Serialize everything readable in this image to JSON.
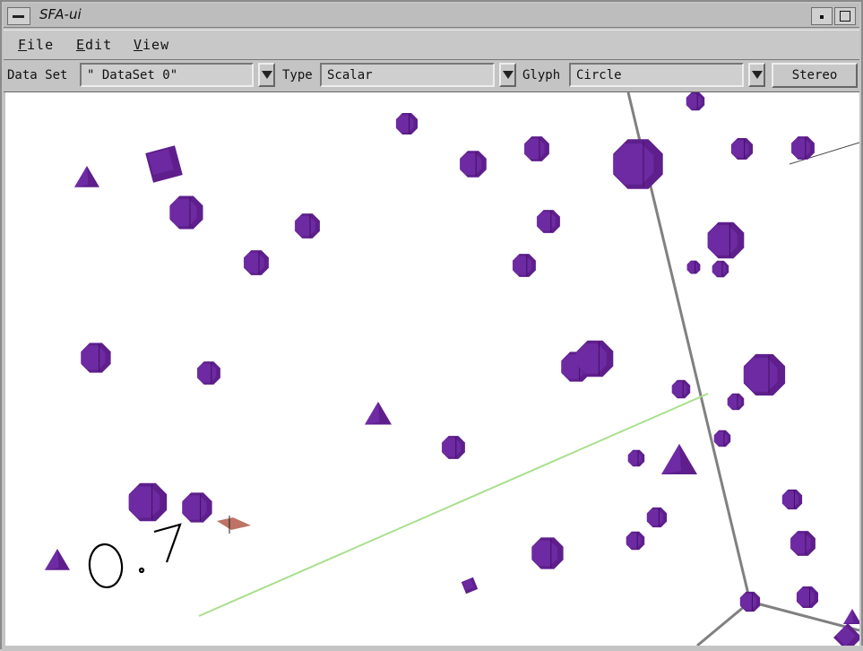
{
  "window": {
    "title": "SFA-ui"
  },
  "menubar": {
    "file": {
      "mnemonic": "F",
      "rest": "ile"
    },
    "edit": {
      "mnemonic": "E",
      "rest": "dit"
    },
    "view": {
      "mnemonic": "V",
      "rest": "iew"
    }
  },
  "toolbar": {
    "dataset_label": "Data Set",
    "dataset_value": "\" DataSet 0\"",
    "type_label": "Type",
    "type_value": "Scalar",
    "glyph_label": "Glyph",
    "glyph_value": "Circle",
    "stereo_label": "Stereo"
  },
  "viewport": {
    "scale_label": "0.7",
    "glyph_color": "#5e1f8c",
    "glyph_highlight": "#7b33b5",
    "glyph_shadow": "#3d1160",
    "axis_color": "#808080",
    "green_line_color": "#a8e08c"
  }
}
